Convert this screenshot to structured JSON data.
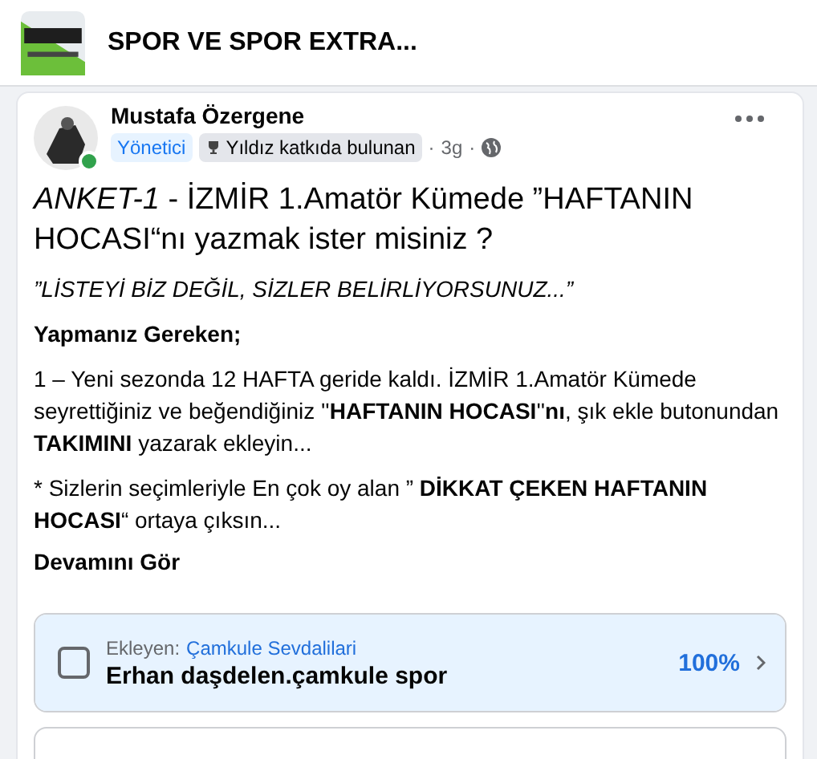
{
  "group": {
    "name": "SPOR VE SPOR EXTRA..."
  },
  "post": {
    "author": "Mustafa Özergene",
    "online": true,
    "role_badge": "Yönetici",
    "contributor_badge": "Yıldız katkıda bulunan",
    "separator": "·",
    "time": "3g",
    "title": "*ANKET-1* - İZMİR 1.Amatör Kümede ”HAFTANIN HOCASI“nı yazmak ister misiniz ?",
    "paragraphs": [
      {
        "kind": "italic",
        "text": "”LİSTEYİ BİZ DEĞİL, SİZLER BELİRLİYORSUNUZ...”"
      },
      {
        "kind": "bold",
        "text": "Yapmanız Gereken;"
      },
      {
        "kind": "plain",
        "text": "1 – Yeni sezonda 12 HAFTA geride kaldı. İZMİR 1.Amatör Kümede seyrettiğiniz ve beğendiğiniz ''**HAFTANIN HOCASI**''**nı**, şık ekle butonundan **TAKIMINI** yazarak ekleyin..."
      },
      {
        "kind": "plain",
        "text": "* Sizlerin seçimleriyle En çok oy alan ” **DİKKAT ÇEKEN HAFTANIN HOCASI**“ ortaya çıksın..."
      }
    ],
    "see_more": "Devamını Gör"
  },
  "poll": {
    "options": [
      {
        "kind": "full",
        "added_by_label": "Ekleyen:",
        "added_by": "Çamkule Sevdalilari",
        "text": "Erhan daşdelen.çamkule spor",
        "percent": "100%",
        "level": 1,
        "checked": false
      },
      {
        "kind": "cut_off"
      }
    ]
  }
}
